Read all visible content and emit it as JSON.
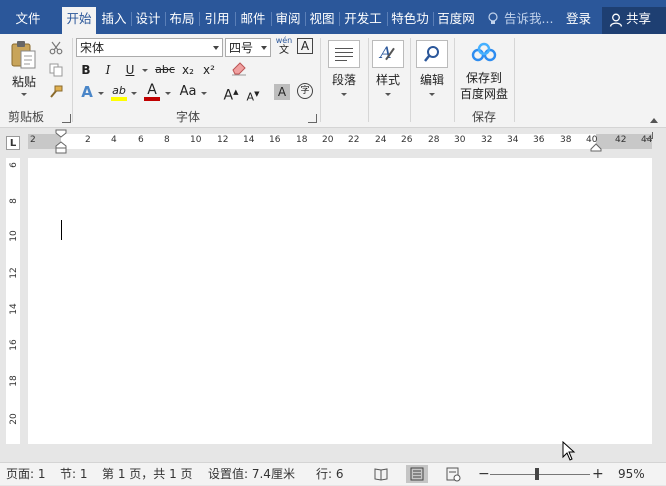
{
  "tabs": [
    {
      "label": "文件",
      "active": false
    },
    {
      "label": "开始",
      "active": true
    },
    {
      "label": "插入",
      "active": false
    },
    {
      "label": "设计",
      "active": false
    },
    {
      "label": "布局",
      "active": false
    },
    {
      "label": "引用",
      "active": false
    },
    {
      "label": "邮件",
      "active": false
    },
    {
      "label": "审阅",
      "active": false
    },
    {
      "label": "视图",
      "active": false
    },
    {
      "label": "开发工",
      "active": false
    },
    {
      "label": "特色功",
      "active": false
    },
    {
      "label": "百度网",
      "active": false
    }
  ],
  "tellme": "告诉我...",
  "login": "登录",
  "share": "共享",
  "ribbon": {
    "clipboard": {
      "paste": "粘贴",
      "group": "剪贴板"
    },
    "font": {
      "name": "宋体",
      "size": "四号",
      "phonetic_top": "wén",
      "phonetic_bottom": "文",
      "border_char": "A",
      "bold": "B",
      "italic": "I",
      "underline": "U",
      "strike": "abc",
      "sub": "x₂",
      "sup": "x²",
      "text_effect": "A",
      "highlight": "ab",
      "font_color": "A",
      "case": "Aa",
      "grow": "A",
      "shrink": "A",
      "shading": "A",
      "enclose": "字",
      "group": "字体"
    },
    "paragraph": {
      "label": "段落"
    },
    "styles": {
      "label": "样式"
    },
    "editing": {
      "label": "编辑"
    },
    "save": {
      "line1": "保存到",
      "line2": "百度网盘",
      "group": "保存"
    }
  },
  "ruler": {
    "tab_selector": "L",
    "h_labels": [
      "2",
      "2",
      "4",
      "6",
      "8",
      "10",
      "12",
      "14",
      "16",
      "18",
      "20",
      "22",
      "24",
      "26",
      "28",
      "30",
      "32",
      "34",
      "36",
      "38",
      "40",
      "42",
      "44"
    ],
    "v_labels": [
      "6",
      "8",
      "10",
      "12",
      "14",
      "16",
      "18",
      "20"
    ]
  },
  "status": {
    "page": "页面: 1",
    "section": "节: 1",
    "pages": "第 1 页，共 1 页",
    "setting": "设置值: 7.4厘米",
    "line": "行: 6",
    "zoom_out": "−",
    "zoom_in": "+",
    "zoom": "95%"
  },
  "colors": {
    "accent": "#2b579a",
    "highlight": "#ffff00",
    "font_color": "#c00000"
  }
}
